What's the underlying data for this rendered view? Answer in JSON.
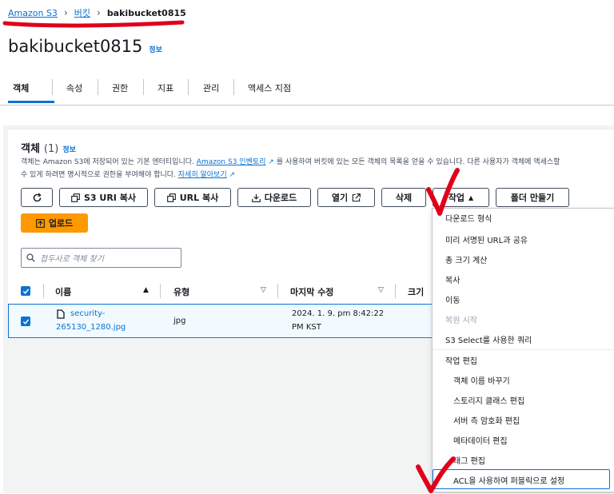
{
  "breadcrumb": {
    "root": "Amazon S3",
    "buckets": "버킷",
    "current": "bakibucket0815"
  },
  "page": {
    "title": "bakibucket0815",
    "info": "정보"
  },
  "tabs": [
    "객체",
    "속성",
    "권한",
    "지표",
    "관리",
    "액세스 지점"
  ],
  "objects": {
    "heading": "객체",
    "count": "(1)",
    "info": "정보",
    "description_1": "객체는 Amazon S3에 저장되어 있는 기본 엔터티입니다.",
    "inventory_link": "Amazon S3 인벤토리",
    "description_2": "를 사용하여 버킷에 있는 모든 객체의 목록을 얻을 수 있습니다. 다른 사용자가 객체에 액세스할",
    "description_3": "수 있게 하려면 명시적으로 권한을 부여해야 합니다.",
    "learn_more": "자세히 알아보기"
  },
  "toolbar": {
    "copy_s3_uri": "S3 URI 복사",
    "copy_url": "URL 복사",
    "download": "다운로드",
    "open": "열기",
    "delete": "삭제",
    "actions": "작업",
    "create_folder": "폴더 만들기",
    "upload": "업로드"
  },
  "search": {
    "placeholder": "접두사로 객체 찾기"
  },
  "table": {
    "headers": {
      "name": "이름",
      "type": "유형",
      "modified": "마지막 수정",
      "size": "크기"
    },
    "rows": [
      {
        "name_line1": "security-",
        "name_line2": "265130_1280.jpg",
        "type": "jpg",
        "modified_line1": "2024. 1. 9. pm 8:42:22",
        "modified_line2": "PM KST"
      }
    ]
  },
  "actions_menu": {
    "items": [
      "다운로드 형식",
      "미리 서명된 URL과 공유",
      "총 크기 계산",
      "복사",
      "이동",
      "복원 시작",
      "S3 Select를 사용한 쿼리"
    ],
    "edit_section": "작업 편집",
    "edit_items": [
      "객체 이름 바꾸기",
      "스토리지 클래스 편집",
      "서버 측 암호화 편집",
      "메타데이터 편집",
      "태그 편집",
      "ACL을 사용하여 퍼블릭으로 설정"
    ]
  },
  "colors": {
    "accent": "#0972d3",
    "primary_button": "#ff9900",
    "annotation_red": "#e0001b"
  },
  "icons": [
    "refresh-icon",
    "copy-icon",
    "download-icon",
    "external-link-icon",
    "caret-up-icon",
    "upload-icon",
    "search-icon",
    "sort-icon",
    "file-icon",
    "checkmark-icon",
    "chevron-right-icon"
  ]
}
